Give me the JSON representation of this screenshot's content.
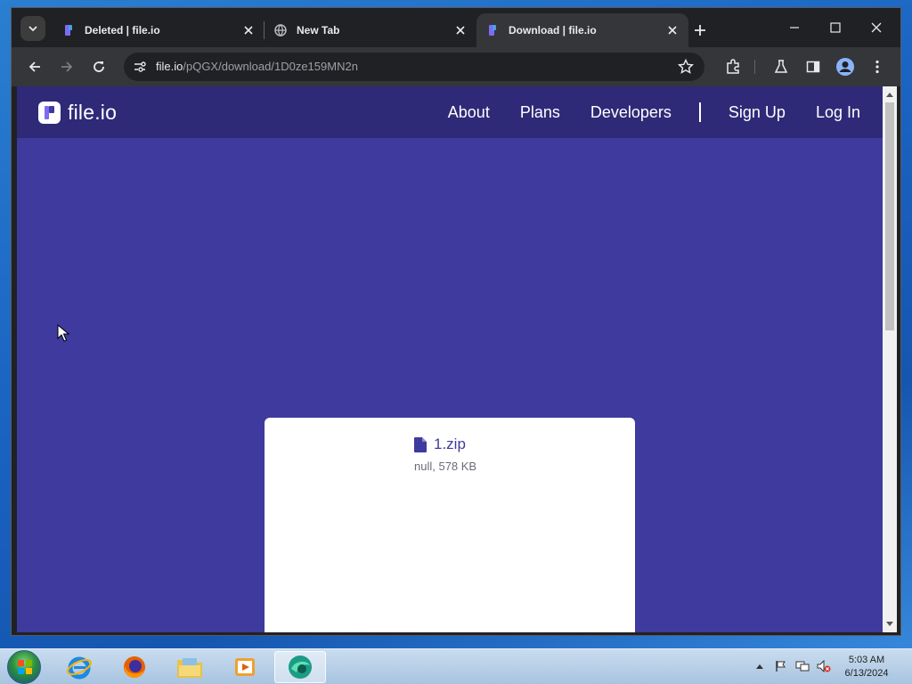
{
  "browser": {
    "tabs": [
      {
        "title": "Deleted | file.io",
        "active": false
      },
      {
        "title": "New Tab",
        "active": false
      },
      {
        "title": "Download | file.io",
        "active": true
      }
    ],
    "url_host": "file.io",
    "url_path": "/pQGX/download/1D0ze159MN2n"
  },
  "site": {
    "logo_text": "file.io",
    "nav": {
      "about": "About",
      "plans": "Plans",
      "developers": "Developers",
      "sign_up": "Sign Up",
      "log_in": "Log In"
    }
  },
  "file": {
    "name": "1.zip",
    "meta": "null, 578 KB"
  },
  "taskbar": {
    "time": "5:03 AM",
    "date": "6/13/2024"
  },
  "colors": {
    "page_bg": "#3f3a9d",
    "nav_bg": "#2e2a78",
    "accent": "#3f3a9d"
  }
}
